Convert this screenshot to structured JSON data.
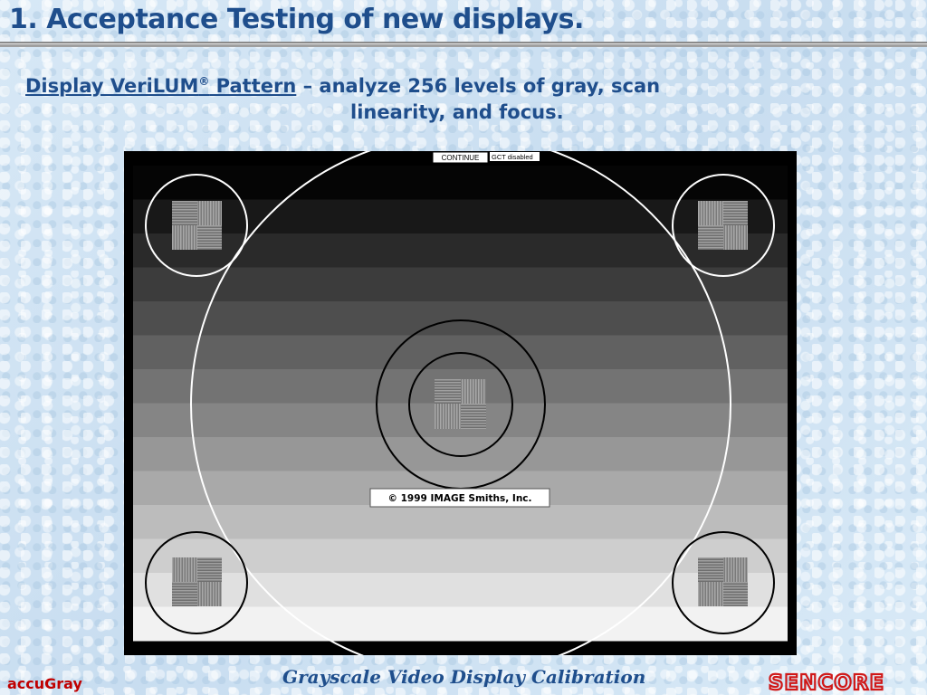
{
  "slide": {
    "title": "1. Acceptance Testing of new displays.",
    "subtitle_link": "Display VeriLUM",
    "subtitle_reg": "®",
    "subtitle_link_tail": " Pattern",
    "subtitle_rest_line1": " – analyze 256 levels of gray, scan",
    "subtitle_rest_line2": "linearity, and focus."
  },
  "pattern": {
    "continue_label": "CONTINUE",
    "gct_status": "GCT disabled",
    "copyright": "© 1999 IMAGE Smiths, Inc.",
    "gray_bands": 14,
    "gray_start": 0,
    "gray_end": 255
  },
  "footer": {
    "left_brand": "accuGray",
    "center_caption": "Grayscale Video Display Calibration",
    "logo_text": "SENCORE",
    "logo_color": "#d01818"
  }
}
